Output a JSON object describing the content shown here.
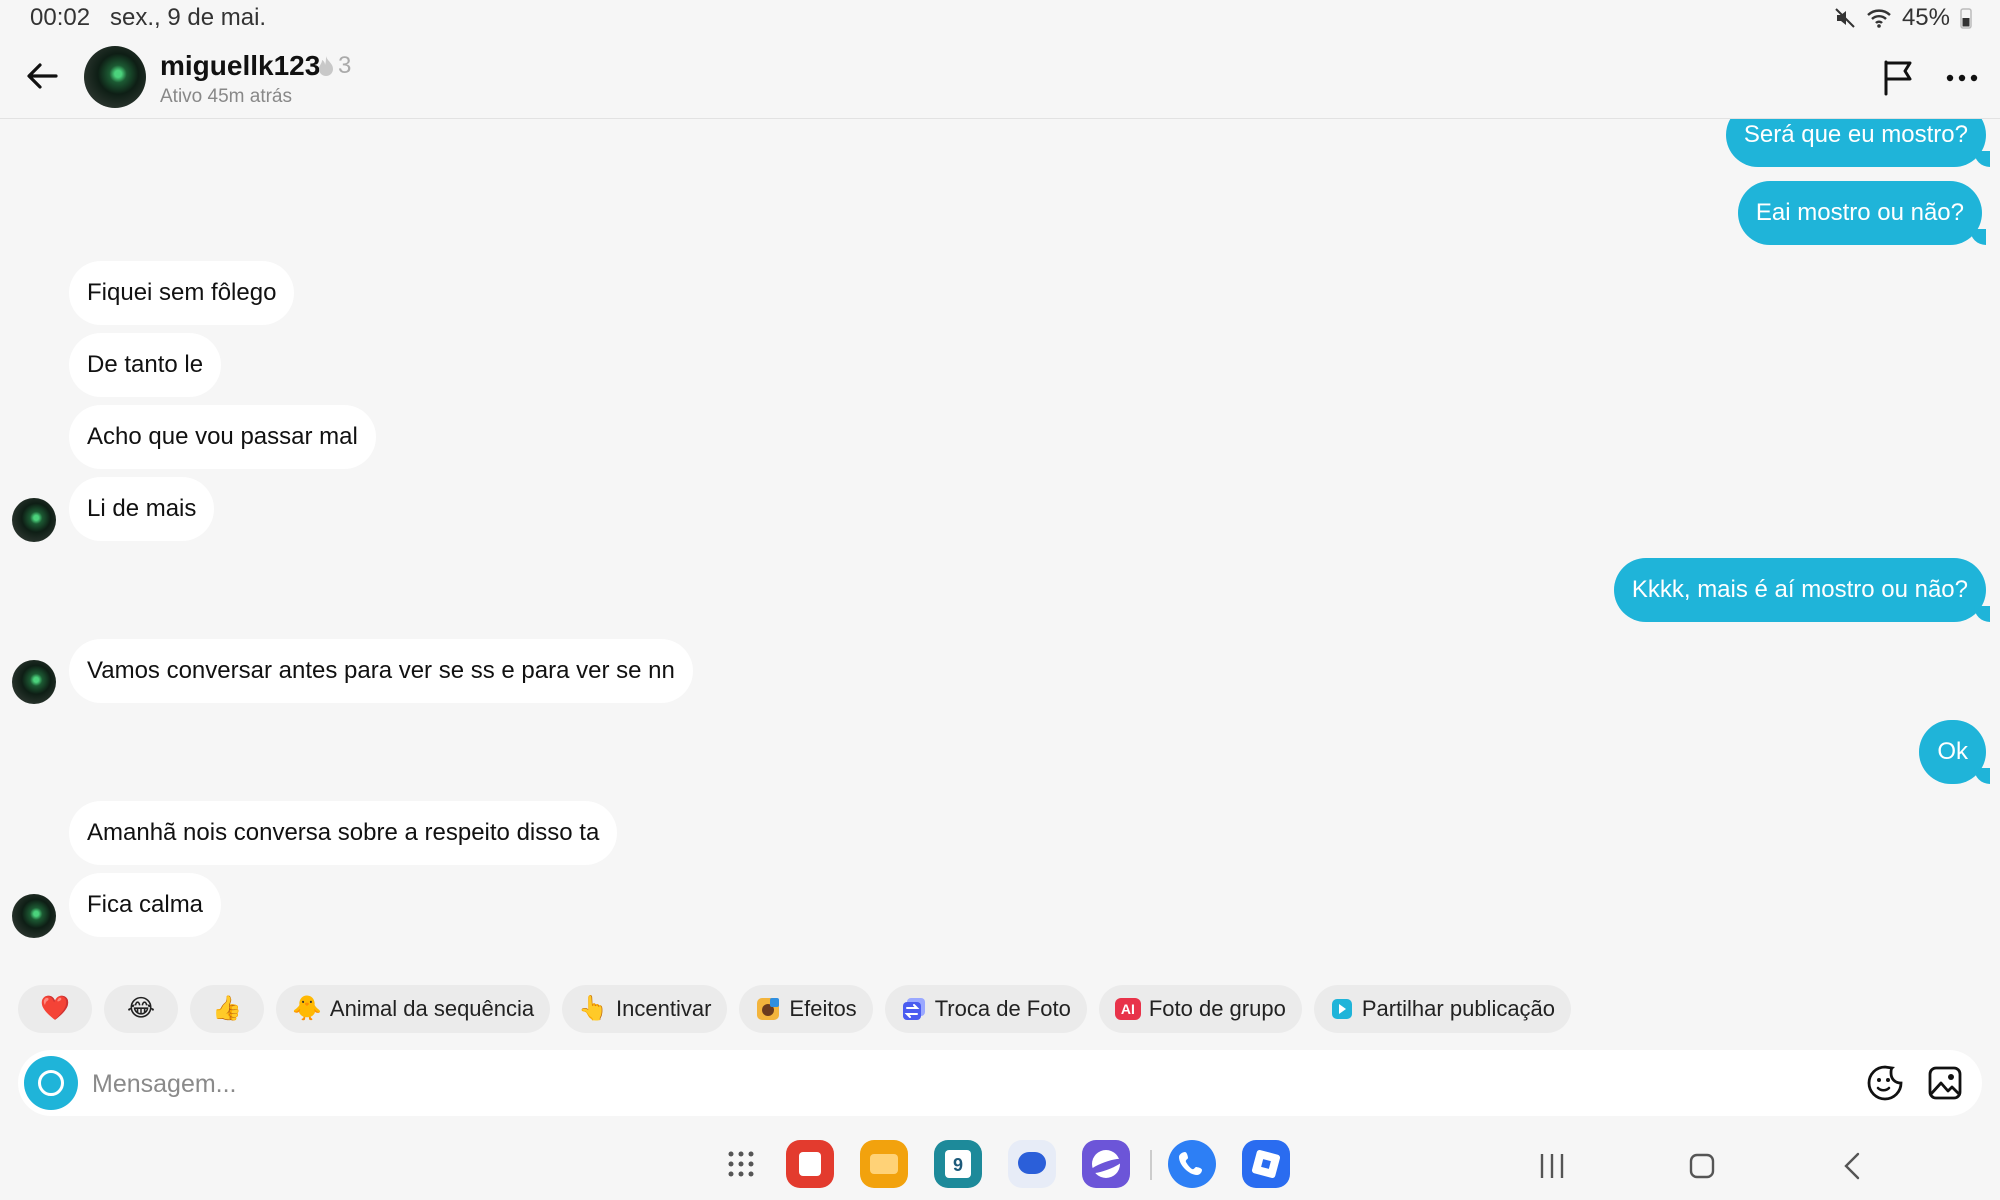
{
  "status_bar": {
    "time": "00:02",
    "date": "sex., 9 de mai.",
    "battery": "45%",
    "icons": [
      "mute-icon",
      "wifi-icon",
      "battery-icon"
    ]
  },
  "header": {
    "username": "miguellk123",
    "streak_count": "3",
    "status": "Ativo 45m atrás",
    "icons": [
      "back-arrow-icon",
      "flag-icon",
      "more-icon"
    ]
  },
  "messages": [
    {
      "from": "me",
      "text": "Será que eu mostro?"
    },
    {
      "from": "me",
      "text": "Eai mostro ou não?"
    },
    {
      "from": "them",
      "text": "Fiquei sem fôlego"
    },
    {
      "from": "them",
      "text": "De tanto le"
    },
    {
      "from": "them",
      "text": "Acho que vou passar mal"
    },
    {
      "from": "them",
      "text": "Li de mais"
    },
    {
      "from": "me",
      "text": "Kkkk, mais é aí mostro ou não?"
    },
    {
      "from": "them",
      "text": "Vamos conversar antes para ver se ss e para ver se nn"
    },
    {
      "from": "me",
      "text": "Ok"
    },
    {
      "from": "them",
      "text": "Amanhã nois conversa sobre a respeito disso ta"
    },
    {
      "from": "them",
      "text": "Fica calma"
    }
  ],
  "quick_replies": {
    "heart": "❤️",
    "laugh": "😂",
    "thumbs": "👍",
    "animal_icon": "🐥",
    "animal_label": "Animal da sequência",
    "cheer_icon": "👆",
    "cheer_label": "Incentivar",
    "effects_label": "Efeitos",
    "swap_label": "Troca de Foto",
    "ai_badge": "AI",
    "group_label": "Foto de grupo",
    "share_label": "Partilhar publicação"
  },
  "composer": {
    "placeholder": "Mensagem..."
  },
  "dock": {
    "calendar_day": "9"
  },
  "colors": {
    "accent": "#1fb4d9",
    "background": "#f6f6f6",
    "incoming_bubble": "#ffffff"
  }
}
